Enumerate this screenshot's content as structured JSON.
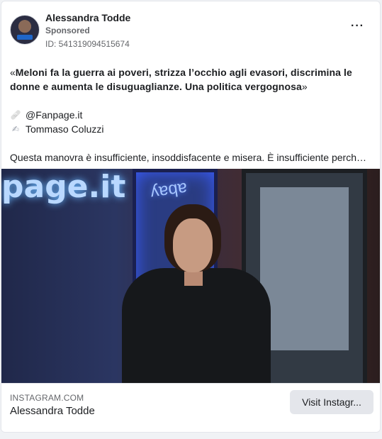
{
  "header": {
    "advertiser_name": "Alessandra Todde",
    "sponsored_label": "Sponsored",
    "ad_id": "ID: 541319094515674",
    "more_label": "···"
  },
  "post": {
    "quote_open": "«",
    "quote_text": "Meloni fa la guerra ai poveri, strizza l’occhio agli evasori, discrimina le donne e aumenta le disuguaglianze. Una politica vergognosa",
    "quote_close": "»",
    "credits": [
      {
        "icon": "bandage-icon",
        "text": "@Fanpage.it"
      },
      {
        "icon": "writing-hand-icon",
        "text": "Tommaso Coluzzi"
      }
    ],
    "description": "Questa manovra è insufficiente, insoddisfacente e misera. È insufficiente perché…"
  },
  "media": {
    "neon_left": "page.it",
    "neon_right": "ʎɐqɐ"
  },
  "footer": {
    "domain": "INSTAGRAM.COM",
    "title": "Alessandra Todde",
    "cta_label": "Visit Instagr..."
  },
  "colors": {
    "background": "#f0f2f5",
    "card": "#ffffff",
    "cta_bg": "#e4e6eb",
    "secondary_text": "#65676b"
  }
}
